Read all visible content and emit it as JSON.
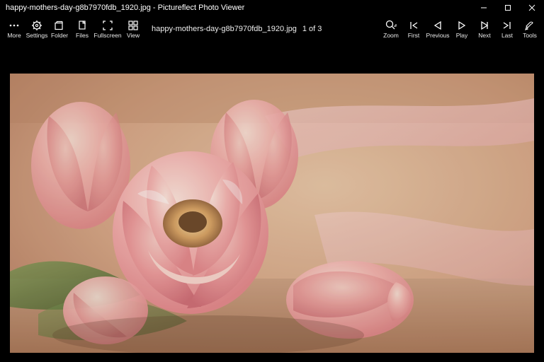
{
  "window": {
    "title": "happy-mothers-day-g8b7970fdb_1920.jpg - Pictureflect Photo Viewer"
  },
  "toolbar": {
    "left": {
      "more": "More",
      "settings": "Settings",
      "folder": "Folder",
      "files": "Files",
      "fullscreen": "Fullscreen",
      "view": "View"
    },
    "right": {
      "zoom": "Zoom",
      "first": "First",
      "previous": "Previous",
      "play": "Play",
      "next": "Next",
      "last": "Last",
      "tools": "Tools"
    }
  },
  "current": {
    "filename": "happy-mothers-day-g8b7970fdb_1920.jpg",
    "position": "1 of 3"
  }
}
